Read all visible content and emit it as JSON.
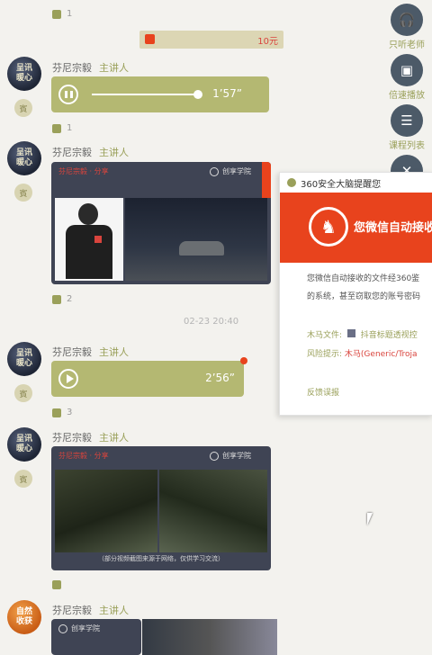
{
  "messages": {
    "speaker_name": "芬尼宗毅",
    "speaker_role": "主讲人",
    "avatar_text": "呈讯\n暖心",
    "avatar_text_orange": "自然\n收获",
    "badge_text": "賓",
    "reward_text": "10元",
    "like_counts": [
      "1",
      "1",
      "2",
      "3"
    ],
    "audio1_duration": "1’57”",
    "audio2_duration": "2’56”",
    "timestamp": "02-23 20:40",
    "card_title": "芬尼宗毅 · 分享",
    "card_brand": "创享学院",
    "card2_caption": "（部分视频截图来源于网络，仅供学习交流）"
  },
  "sidebar": {
    "items": [
      {
        "label": "只听老师",
        "icon": "headphones-icon"
      },
      {
        "label": "倍速播放",
        "icon": "speed-icon"
      },
      {
        "label": "课程列表",
        "icon": "list-icon"
      }
    ]
  },
  "popup": {
    "title": "360安全大脑提醒您",
    "headline": "您微信自动接收",
    "body1": "您微信自动接收的文件经360鉴",
    "body2": "的系统，甚至窃取您的账号密码",
    "file_label": "木马文件:",
    "file_value": "抖音标题透视控",
    "risk_label": "风险提示:",
    "risk_value": "木马(Generic/Troja",
    "feedback": "反馈误报"
  },
  "colors": {
    "accent_olive": "#9aa05a",
    "audio_bg": "#b4b872",
    "card_bg": "#3f4454",
    "alert_red": "#e8431d"
  }
}
